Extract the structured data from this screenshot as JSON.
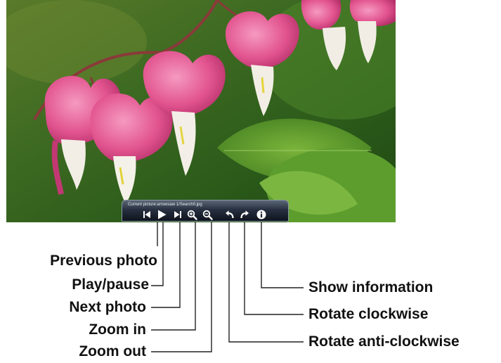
{
  "viewer": {
    "current_picture_text": "Current picture:arrowsaw 1/Search0.jpg"
  },
  "toolbar": {
    "buttons": [
      {
        "id": "previous",
        "icon": "skip-previous-icon"
      },
      {
        "id": "play",
        "icon": "play-icon"
      },
      {
        "id": "next",
        "icon": "skip-next-icon"
      },
      {
        "id": "zoom_in",
        "icon": "zoom-in-icon"
      },
      {
        "id": "zoom_out",
        "icon": "zoom-out-icon"
      },
      {
        "id": "rotate_anticlockwise",
        "icon": "rotate-left-icon"
      },
      {
        "id": "rotate_clockwise",
        "icon": "rotate-right-icon"
      },
      {
        "id": "info",
        "icon": "info-icon"
      }
    ]
  },
  "callouts": {
    "previous_photo": "Previous photo",
    "play_pause": "Play/pause",
    "next_photo": "Next photo",
    "zoom_in": "Zoom in",
    "zoom_out": "Zoom out",
    "show_information": "Show information",
    "rotate_clockwise": "Rotate clockwise",
    "rotate_anticlockwise": "Rotate anti-clockwise"
  },
  "colors": {
    "osd_background": "#1a2230",
    "osd_icon": "#ffffff",
    "leader_line": "#222222",
    "label_text": "#111111",
    "flower_pink": "#e8508f",
    "flower_white": "#f4f1ea",
    "foliage_green": "#3f7a25"
  }
}
